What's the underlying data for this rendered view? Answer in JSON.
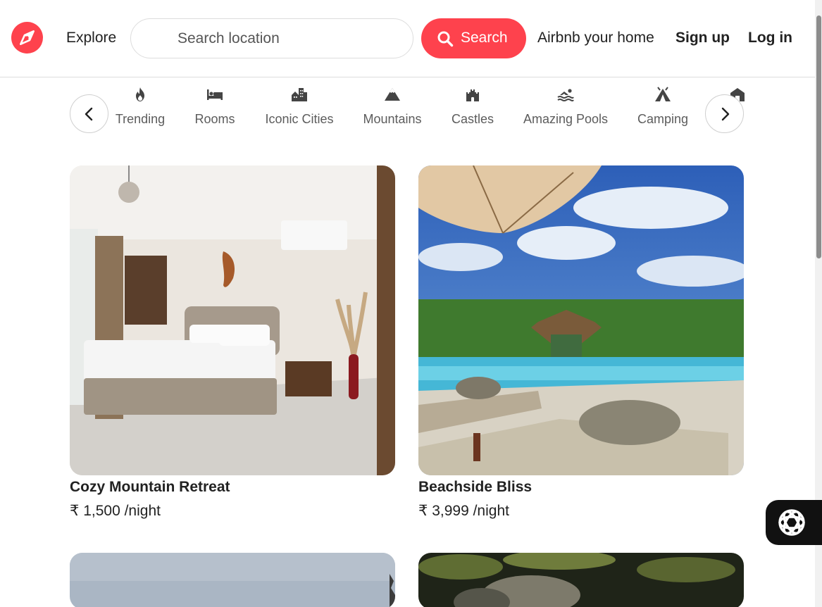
{
  "header": {
    "explore_label": "Explore",
    "search_placeholder": "Search location",
    "search_button_label": "Search",
    "host_link": "Airbnb your home",
    "signup_label": "Sign up",
    "login_label": "Log in"
  },
  "colors": {
    "brand": "#fe424d",
    "text": "#222222",
    "muted": "#5c5c5c"
  },
  "filters": [
    {
      "label": "Trending",
      "icon": "fire-icon"
    },
    {
      "label": "Rooms",
      "icon": "bed-icon"
    },
    {
      "label": "Iconic Cities",
      "icon": "city-icon"
    },
    {
      "label": "Mountains",
      "icon": "mountain-icon"
    },
    {
      "label": "Castles",
      "icon": "castle-icon"
    },
    {
      "label": "Amazing Pools",
      "icon": "swimmer-icon"
    },
    {
      "label": "Camping",
      "icon": "tent-icon"
    }
  ],
  "listings": [
    {
      "title": "Cozy Mountain Retreat",
      "price": "₹ 1,500 /night"
    },
    {
      "title": "Beachside Bliss",
      "price": "₹ 3,999 /night"
    },
    {
      "title": "",
      "price": ""
    },
    {
      "title": "",
      "price": ""
    }
  ]
}
